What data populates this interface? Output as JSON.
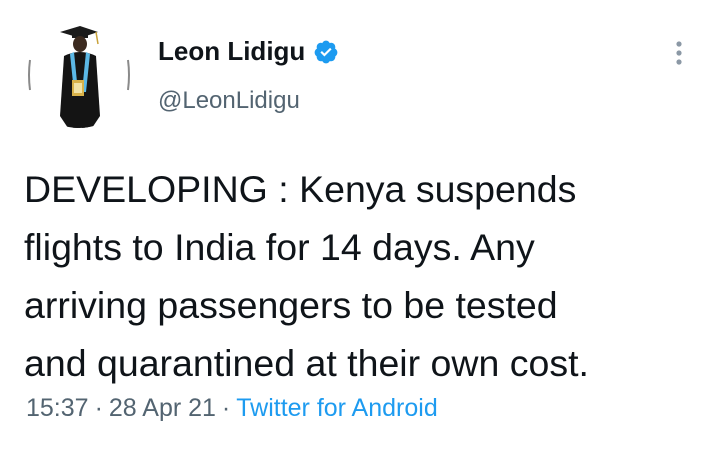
{
  "author": {
    "display_name": "Leon Lidigu",
    "handle": "@LeonLidigu",
    "verified": true
  },
  "tweet": {
    "text": "DEVELOPING : Kenya suspends\nflights to India for 14 days. Any\narriving passengers to be tested\nand quarantined at their own cost."
  },
  "meta": {
    "time": "15:37",
    "date": "28 Apr 21",
    "source": "Twitter for Android",
    "separator": "·"
  },
  "icons": {
    "more": "more-vertical-icon",
    "verified": "verified-badge-icon"
  },
  "colors": {
    "verified_blue": "#1d9bf0",
    "link_blue": "#1d9bf0",
    "secondary_text": "#536471",
    "primary_text": "#0f1419"
  }
}
